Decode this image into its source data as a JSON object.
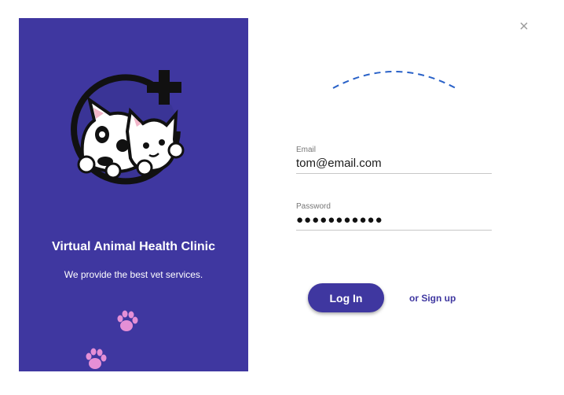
{
  "colors": {
    "brand": "#3f37a0",
    "panel_text": "#ffffff",
    "paw": "#e58fd6",
    "arc": "#2a62c8"
  },
  "brand_panel": {
    "clinic_name": "Virtual Animal Health Clinic",
    "tagline": "We provide the best vet services.",
    "logo_icon": "pet-clinic-logo-icon",
    "decor_icons": [
      "paw-print-icon",
      "paw-print-icon"
    ]
  },
  "dialog": {
    "close_icon": "close-icon",
    "loading_icon": "loading-arc-icon"
  },
  "form": {
    "email": {
      "label": "Email",
      "value": "tom@email.com"
    },
    "password": {
      "label": "Password",
      "value": "●●●●●●●●●●●"
    },
    "login_label": "Log In",
    "signup_label": "or Sign up"
  }
}
